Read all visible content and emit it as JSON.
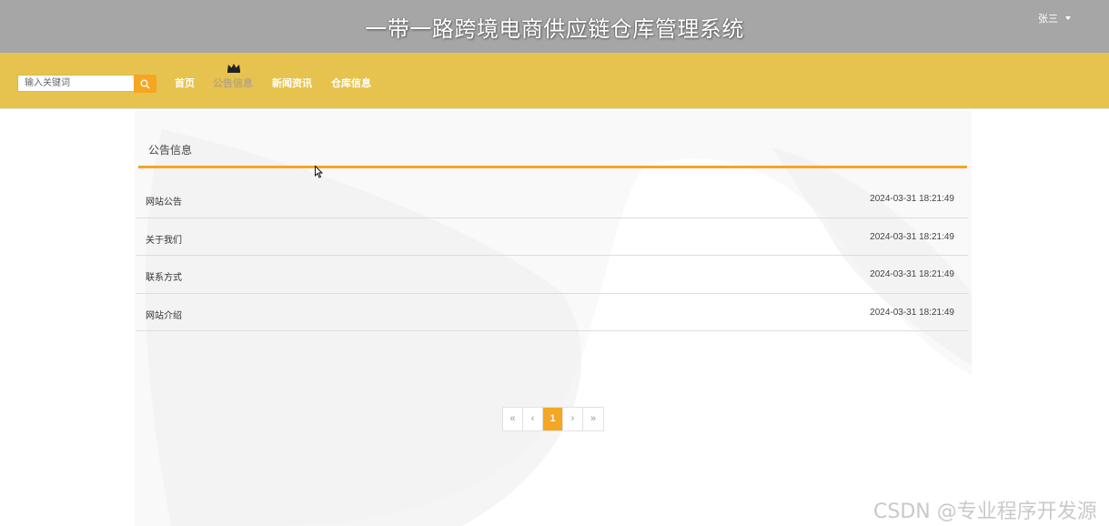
{
  "header": {
    "title": "一带一路跨境电商供应链仓库管理系统",
    "user_name": "张三"
  },
  "navbar": {
    "search_placeholder": "输入关键词",
    "links": [
      "首页",
      "公告信息",
      "新闻资讯",
      "仓库信息"
    ],
    "active_link": "公告信息",
    "accent_color": "#e6c34e",
    "button_color": "#f5a623"
  },
  "panel": {
    "title": "公告信息",
    "items": [
      {
        "title": "网站公告",
        "date": "2024-03-31 18:21:49"
      },
      {
        "title": "关于我们",
        "date": "2024-03-31 18:21:49"
      },
      {
        "title": "联系方式",
        "date": "2024-03-31 18:21:49"
      },
      {
        "title": "网站介绍",
        "date": "2024-03-31 18:21:49"
      }
    ]
  },
  "pagination": {
    "first": "«",
    "prev": "‹",
    "current": "1",
    "next": "›",
    "last": "»"
  },
  "watermark": "CSDN @专业程序开发源"
}
